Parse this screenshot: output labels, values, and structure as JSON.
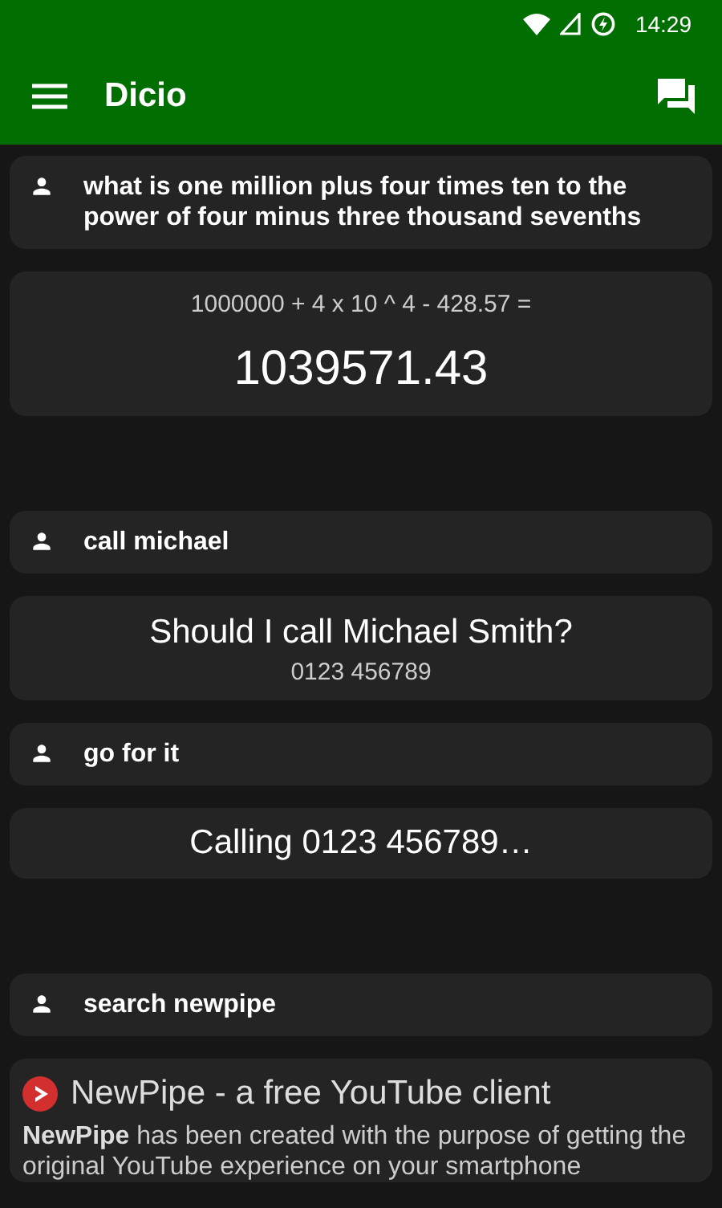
{
  "status_bar": {
    "time": "14:29"
  },
  "app_bar": {
    "title": "Dicio"
  },
  "conversations": [
    [
      {
        "kind": "user",
        "text": "what is one million plus four times ten to the power of four minus three thousand sevenths"
      },
      {
        "kind": "calc",
        "expression": "1000000 + 4 x 10 ^ 4 - 428.57 =",
        "result": "1039571.43"
      }
    ],
    [
      {
        "kind": "user",
        "text": "call michael"
      },
      {
        "kind": "question",
        "text": "Should I call Michael Smith?",
        "detail": "0123 456789"
      },
      {
        "kind": "user",
        "text": "go for it"
      },
      {
        "kind": "message",
        "text": "Calling 0123 456789…"
      }
    ],
    [
      {
        "kind": "user",
        "text": "search newpipe"
      },
      {
        "kind": "web",
        "title": "NewPipe - a free YouTube client",
        "description": "**NewPipe** has been created with the purpose of getting the original YouTube experience on your smartphone"
      }
    ]
  ]
}
